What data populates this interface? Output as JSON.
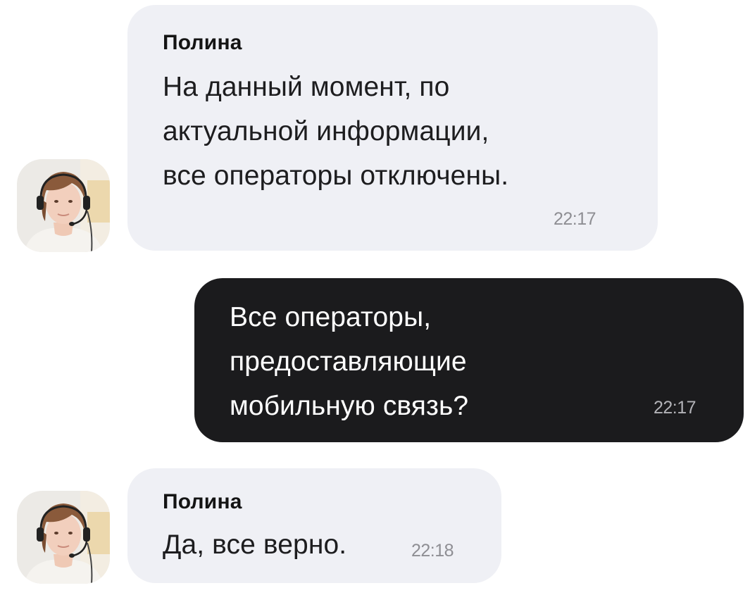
{
  "messages": [
    {
      "direction": "incoming",
      "sender": "Полина",
      "lines": [
        "На данный момент, по",
        "актуальной информации,",
        "все операторы отключены."
      ],
      "time": "22:17"
    },
    {
      "direction": "outgoing",
      "lines": [
        "Все операторы,",
        "предоставляющие",
        "мобильную связь?"
      ],
      "time": "22:17"
    },
    {
      "direction": "incoming",
      "sender": "Полина",
      "lines": [
        "Да, все верно."
      ],
      "time": "22:18"
    }
  ],
  "colors": {
    "incoming_bubble": "#eff0f5",
    "outgoing_bubble": "#1b1b1d",
    "timestamp": "#8e8e93"
  },
  "icons": {
    "avatar": "operator-avatar-with-headset"
  }
}
